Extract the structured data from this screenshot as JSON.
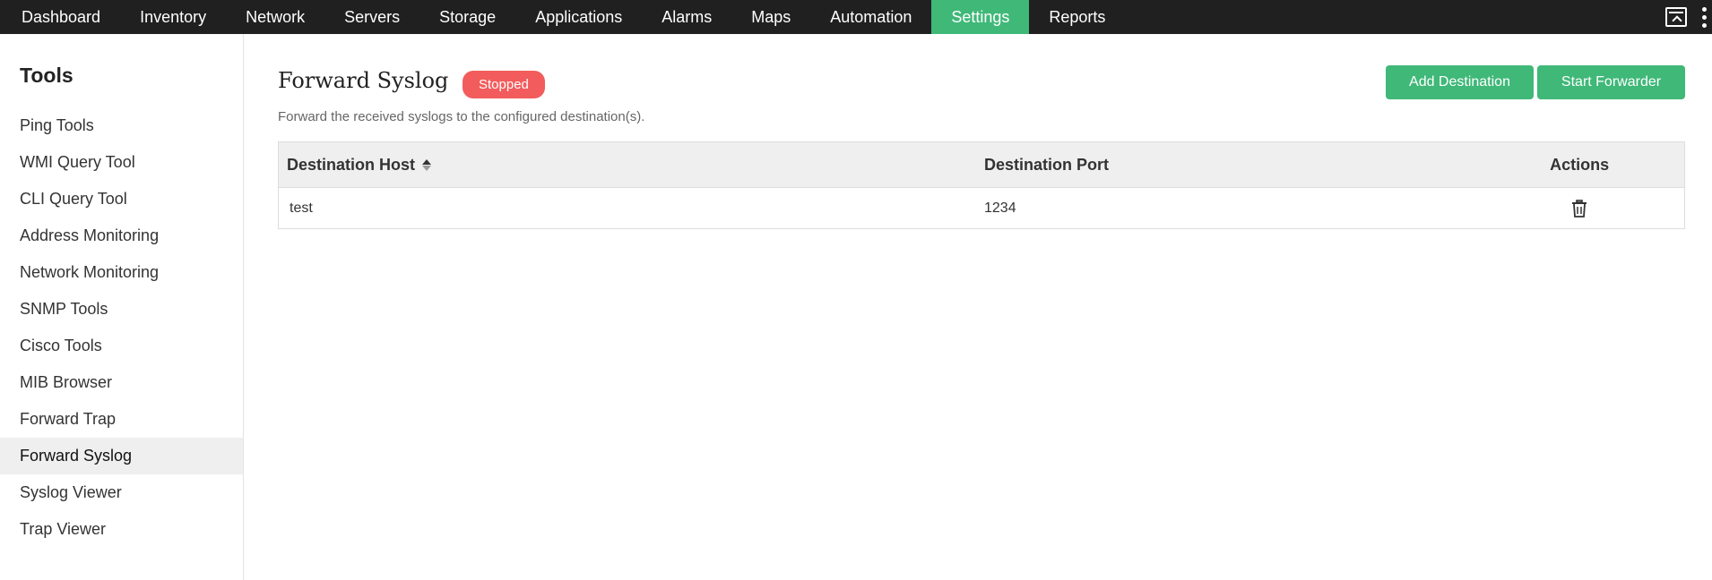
{
  "nav": {
    "items": [
      {
        "label": "Dashboard"
      },
      {
        "label": "Inventory"
      },
      {
        "label": "Network"
      },
      {
        "label": "Servers"
      },
      {
        "label": "Storage"
      },
      {
        "label": "Applications"
      },
      {
        "label": "Alarms"
      },
      {
        "label": "Maps"
      },
      {
        "label": "Automation"
      },
      {
        "label": "Settings"
      },
      {
        "label": "Reports"
      }
    ],
    "active": "Settings",
    "accent_color": "#3fb878"
  },
  "sidebar": {
    "title": "Tools",
    "items": [
      {
        "label": "Ping Tools"
      },
      {
        "label": "WMI Query Tool"
      },
      {
        "label": "CLI Query Tool"
      },
      {
        "label": "Address Monitoring"
      },
      {
        "label": "Network Monitoring"
      },
      {
        "label": "SNMP Tools"
      },
      {
        "label": "Cisco Tools"
      },
      {
        "label": "MIB Browser"
      },
      {
        "label": "Forward Trap"
      },
      {
        "label": "Forward Syslog"
      },
      {
        "label": "Syslog Viewer"
      },
      {
        "label": "Trap Viewer"
      }
    ],
    "active": "Forward Syslog"
  },
  "main": {
    "title": "Forward Syslog",
    "status": "Stopped",
    "status_color": "#f25c5c",
    "subtitle": "Forward the received syslogs to the configured destination(s).",
    "buttons": {
      "add_destination": "Add Destination",
      "start_forwarder": "Start Forwarder"
    },
    "table": {
      "columns": [
        "Destination Host",
        "Destination Port",
        "Actions"
      ],
      "rows": [
        {
          "host": "test",
          "port": "1234",
          "action_icon": "trash-icon"
        }
      ]
    }
  },
  "icons": {
    "window": "screen-icon",
    "more": "kebab-icon"
  }
}
